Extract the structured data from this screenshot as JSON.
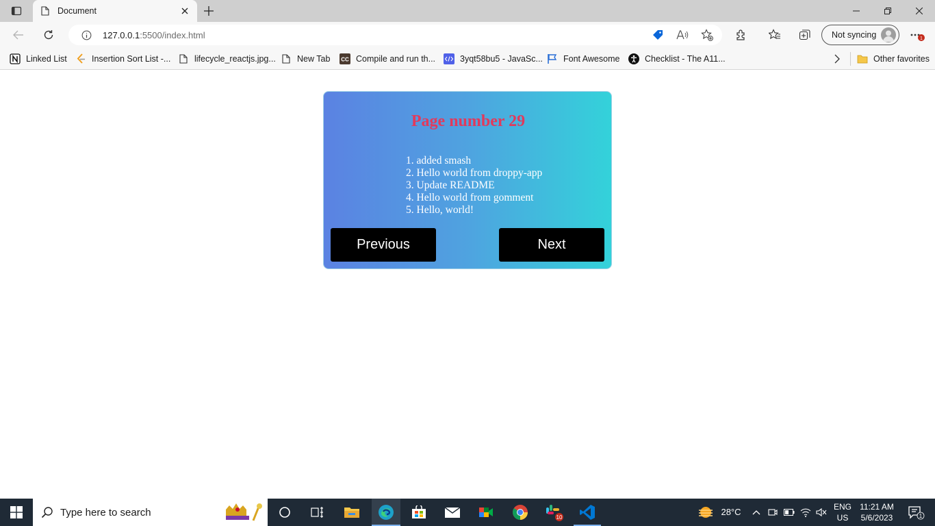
{
  "browser": {
    "tab_title": "Document",
    "url_host": "127.0.0.1",
    "url_path": ":5500/index.html",
    "sync_label": "Not syncing",
    "notification_count": "1"
  },
  "favorites": [
    {
      "label": "Linked List",
      "icon": "notion-icon"
    },
    {
      "label": "Insertion Sort List -...",
      "icon": "leetcode-icon"
    },
    {
      "label": "lifecycle_reactjs.jpg...",
      "icon": "page-icon"
    },
    {
      "label": "New Tab",
      "icon": "page-icon"
    },
    {
      "label": "Compile and run th...",
      "icon": "cc-icon"
    },
    {
      "label": "3yqt58bu5 - JavaSc...",
      "icon": "code-icon"
    },
    {
      "label": "Font Awesome",
      "icon": "flag-icon"
    },
    {
      "label": "Checklist - The A11...",
      "icon": "accessibility-icon"
    }
  ],
  "other_favorites": "Other favorites",
  "card": {
    "title": "Page number 29",
    "items": [
      "1. added smash",
      "2. Hello world from droppy-app",
      "3. Update README",
      "4. Hello world from gomment",
      "5. Hello, world!"
    ],
    "prev_label": "Previous",
    "next_label": "Next"
  },
  "taskbar": {
    "search_placeholder": "Type here to search",
    "temperature": "28°C",
    "lang_top": "ENG",
    "lang_bottom": "US",
    "time": "11:21 AM",
    "date": "5/6/2023",
    "slack_badge": "10",
    "notif_count": "1"
  },
  "colors": {
    "card_gradient_start": "#5b82e2",
    "card_gradient_end": "#33d2da",
    "title_color": "#e13a5c",
    "button_bg": "#000000"
  }
}
